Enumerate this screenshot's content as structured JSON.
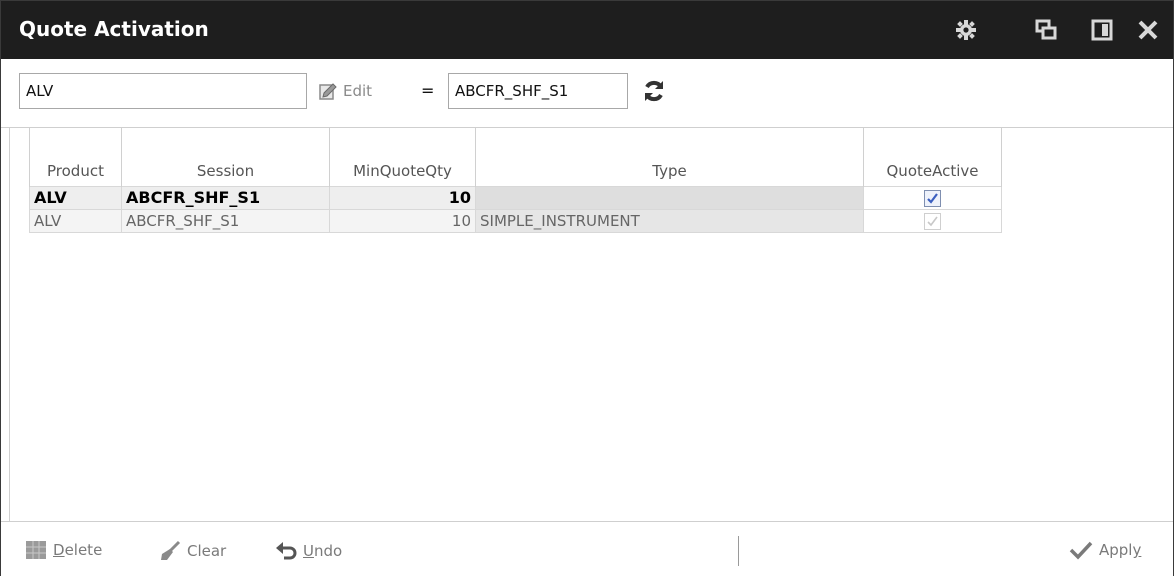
{
  "window": {
    "title": "Quote Activation",
    "icons": [
      "gear-icon",
      "restore-icon",
      "dock-icon",
      "close-icon"
    ]
  },
  "filter": {
    "product_value": "ALV",
    "edit_label": "Edit",
    "equals_label": "=",
    "session_value": "ABCFR_SHF_S1"
  },
  "grid": {
    "columns": [
      "Product",
      "Session",
      "MinQuoteQty",
      "Type",
      "QuoteActive"
    ],
    "rows": [
      {
        "product": "ALV",
        "session": "ABCFR_SHF_S1",
        "min_quote_qty": "10",
        "type": "",
        "quote_active": true,
        "style": "bold"
      },
      {
        "product": "ALV",
        "session": "ABCFR_SHF_S1",
        "min_quote_qty": "10",
        "type": "SIMPLE_INSTRUMENT",
        "quote_active": true,
        "style": "normal"
      }
    ]
  },
  "footer": {
    "delete_label_first": "D",
    "delete_label_rest": "elete",
    "clear_label": "Clear",
    "undo_label_first": "U",
    "undo_label_rest": "ndo",
    "apply_label_main": "Appl",
    "apply_label_under": "y"
  },
  "colors": {
    "titlebar": "#1e1e1e",
    "check_active": "#3b5fc0"
  }
}
